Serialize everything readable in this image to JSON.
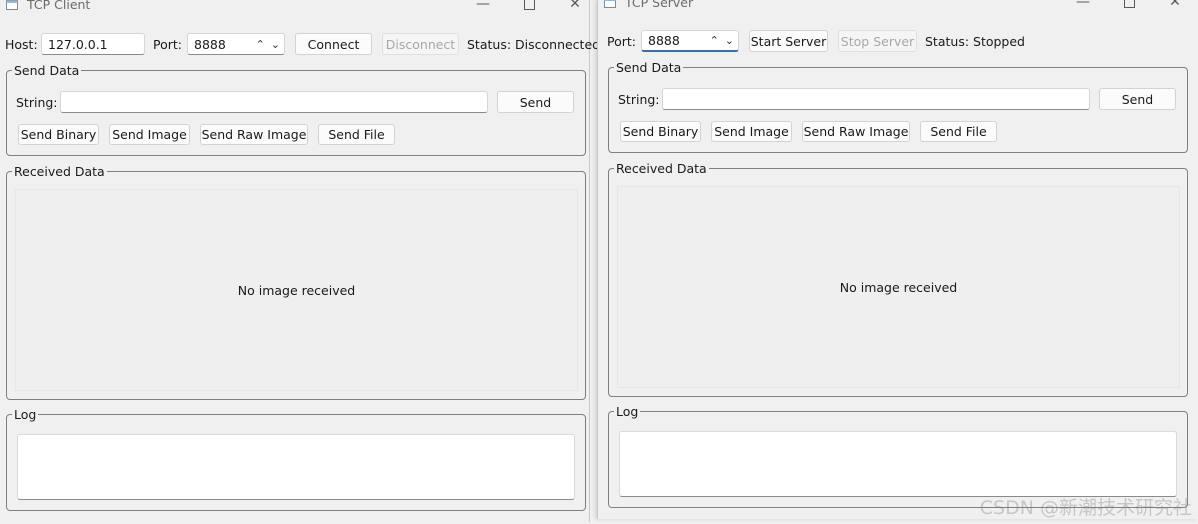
{
  "client": {
    "title": "TCP Client",
    "host_label": "Host:",
    "host_value": "127.0.0.1",
    "port_label": "Port:",
    "port_value": "8888",
    "connect_label": "Connect",
    "disconnect_label": "Disconnect",
    "status_text": "Status: Disconnected",
    "send_group_title": "Send Data",
    "string_label": "String:",
    "string_value": "",
    "send_label": "Send",
    "send_binary_label": "Send Binary",
    "send_image_label": "Send Image",
    "send_raw_image_label": "Send Raw Image",
    "send_file_label": "Send File",
    "received_group_title": "Received Data",
    "no_image_text": "No image received",
    "log_group_title": "Log"
  },
  "server": {
    "title": "TCP Server",
    "port_label": "Port:",
    "port_value": "8888",
    "start_label": "Start Server",
    "stop_label": "Stop Server",
    "status_text": "Status: Stopped",
    "send_group_title": "Send Data",
    "string_label": "String:",
    "string_value": "",
    "send_label": "Send",
    "send_binary_label": "Send Binary",
    "send_image_label": "Send Image",
    "send_raw_image_label": "Send Raw Image",
    "send_file_label": "Send File",
    "received_group_title": "Received Data",
    "no_image_text": "No image received",
    "log_group_title": "Log"
  },
  "icons": {
    "app": "app-window-icon",
    "minimize": "minimize-icon",
    "maximize": "maximize-icon",
    "close": "close-icon",
    "spin_up": "chevron-up-icon",
    "spin_down": "chevron-down-icon"
  },
  "watermark": "CSDN @新潮技术研究社",
  "colors": {
    "background": "#f0f0f0",
    "disabled_text": "#a8a8a8",
    "group_border": "#7f7f7f"
  }
}
